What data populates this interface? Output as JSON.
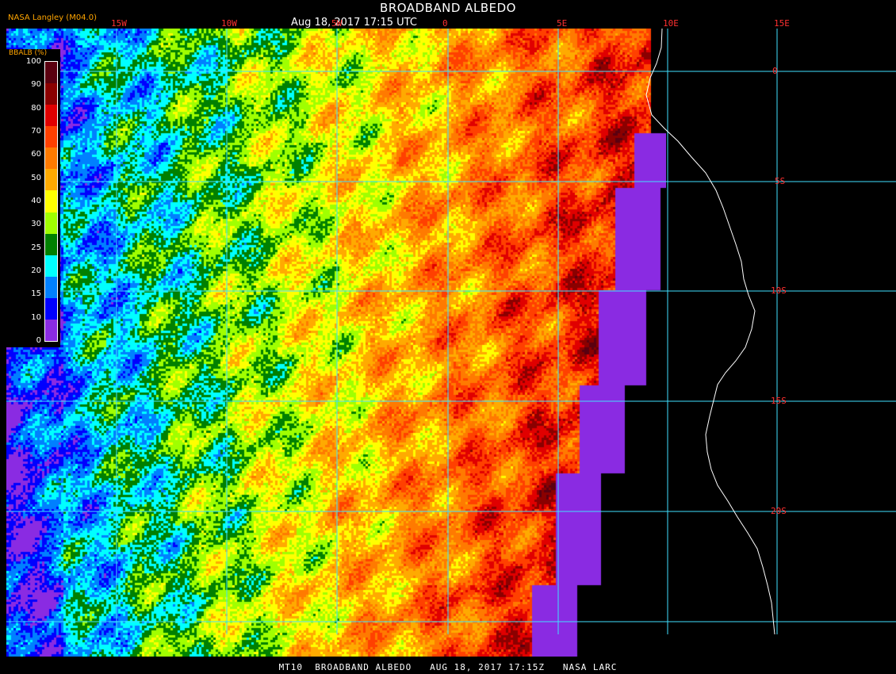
{
  "header": {
    "title": "BROADBAND ALBEDO",
    "subtitle": "Aug 18, 2017 17:15 UTC",
    "producer": "NASA Langley (M04.0)"
  },
  "footer": {
    "text": "MT10  BROADBAND ALBEDO   AUG 18, 2017 17:15Z   NASA LARC"
  },
  "legend": {
    "title": "BBALB (%)",
    "ticks": [
      "100",
      "90",
      "80",
      "70",
      "60",
      "50",
      "40",
      "30",
      "25",
      "20",
      "15",
      "10",
      "0"
    ],
    "colors": [
      "#5a0010",
      "#8b0000",
      "#e00000",
      "#ff4000",
      "#ff7a00",
      "#ffaa00",
      "#ffff00",
      "#a0ff00",
      "#008000",
      "#00ffff",
      "#0080ff",
      "#0000ff",
      "#8a2be2"
    ]
  },
  "grid": {
    "lon_labels": [
      "15W",
      "10W",
      "5W",
      "0",
      "5E",
      "10E",
      "15E"
    ],
    "lat_labels": [
      "0",
      "5S",
      "10S",
      "15S",
      "20S"
    ],
    "line_color": "#40e0ff",
    "label_color": "#ff3030"
  },
  "map": {
    "no_data_color": "#000000",
    "coastline_color": "#ffffff",
    "clear_sky_ocean_color": "#8a2be2"
  }
}
